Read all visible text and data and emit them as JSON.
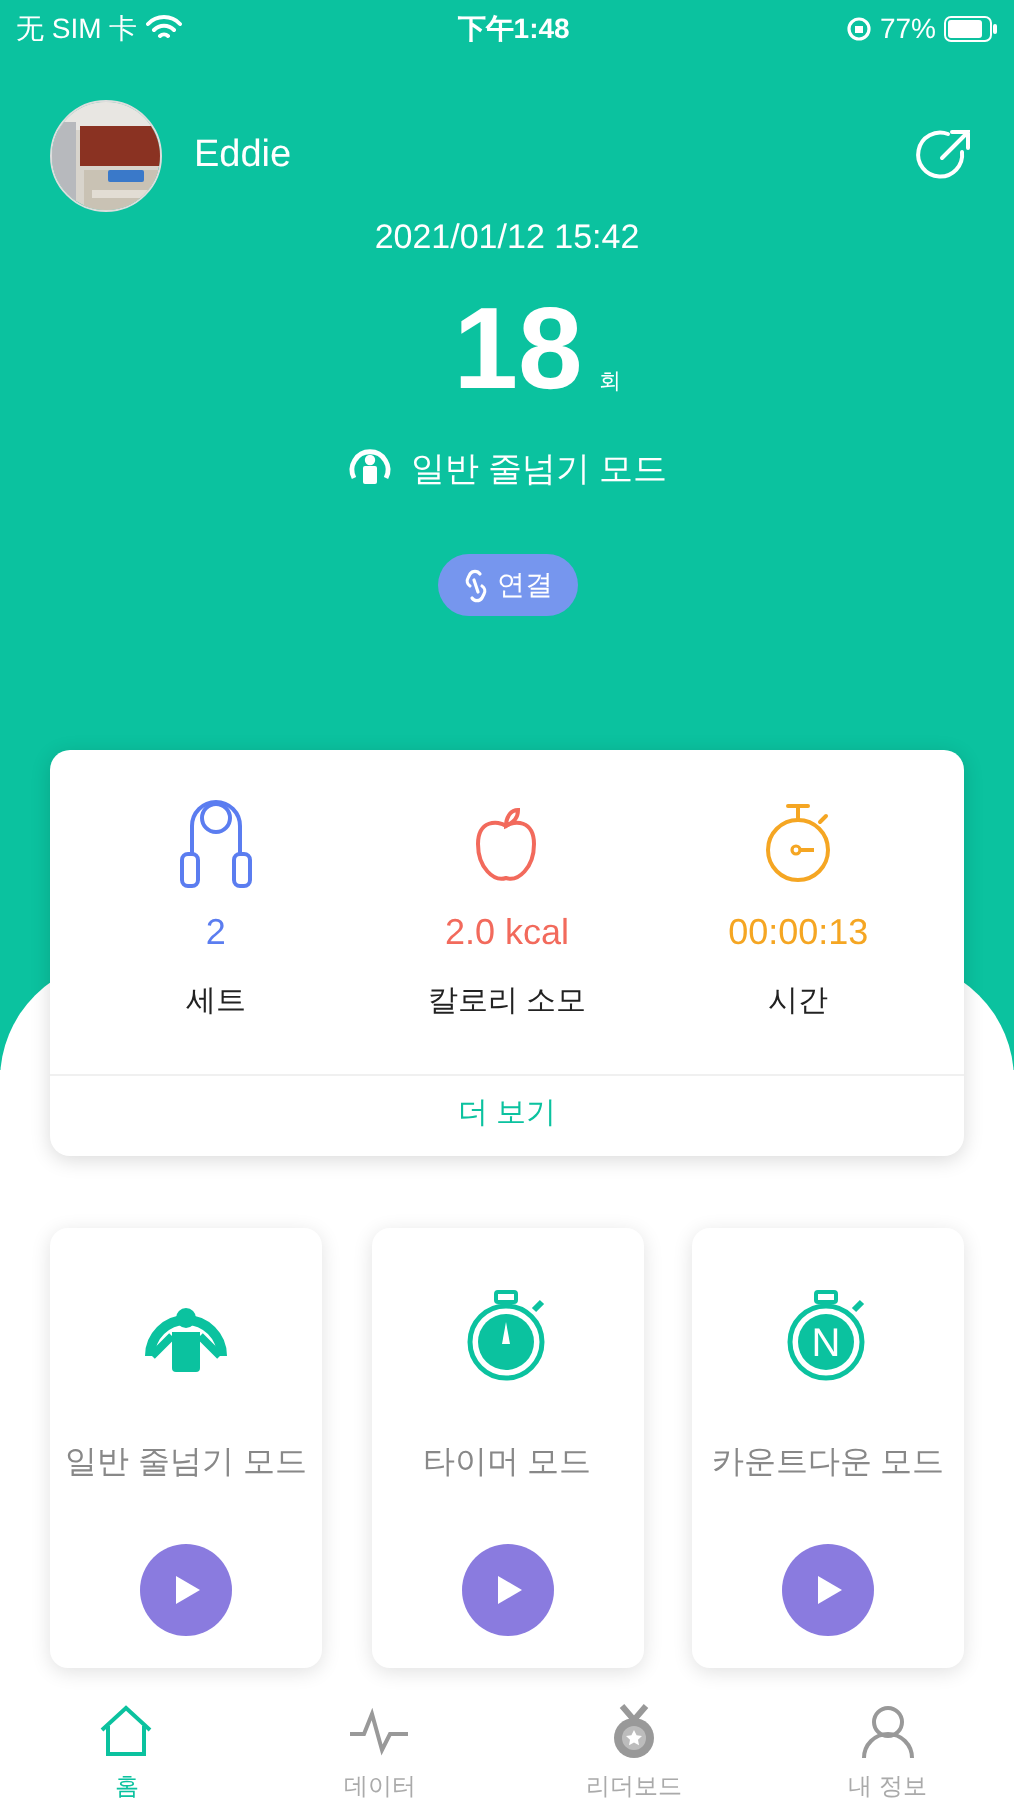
{
  "status_bar": {
    "carrier": "无 SIM 卡",
    "time": "下午1:48",
    "battery": "77%"
  },
  "profile": {
    "name": "Eddie"
  },
  "session": {
    "datetime": "2021/01/12 15:42",
    "count": "18",
    "count_unit": "회",
    "mode": "일반 줄넘기 모드",
    "connect_button": "연결"
  },
  "stats": [
    {
      "kind": "sets",
      "value": "2",
      "label": "세트",
      "color": "#5b7df0"
    },
    {
      "kind": "calories",
      "value": "2.0 kcal",
      "label": "칼로리 소모",
      "color": "#f26a5c"
    },
    {
      "kind": "time",
      "value": "00:00:13",
      "label": "시간",
      "color": "#f5a623"
    }
  ],
  "more_link": "더 보기",
  "modes": [
    {
      "kind": "jump",
      "label": "일반 줄넘기 모드"
    },
    {
      "kind": "timer",
      "label": "타이머 모드"
    },
    {
      "kind": "countdown",
      "label": "카운트다운 모드",
      "icon_letter": "N"
    }
  ],
  "tabs": [
    {
      "kind": "home",
      "label": "홈",
      "selected": true
    },
    {
      "kind": "data",
      "label": "데이터",
      "selected": false
    },
    {
      "kind": "leaderboard",
      "label": "리더보드",
      "selected": false
    },
    {
      "kind": "profile",
      "label": "내 정보",
      "selected": false
    }
  ]
}
